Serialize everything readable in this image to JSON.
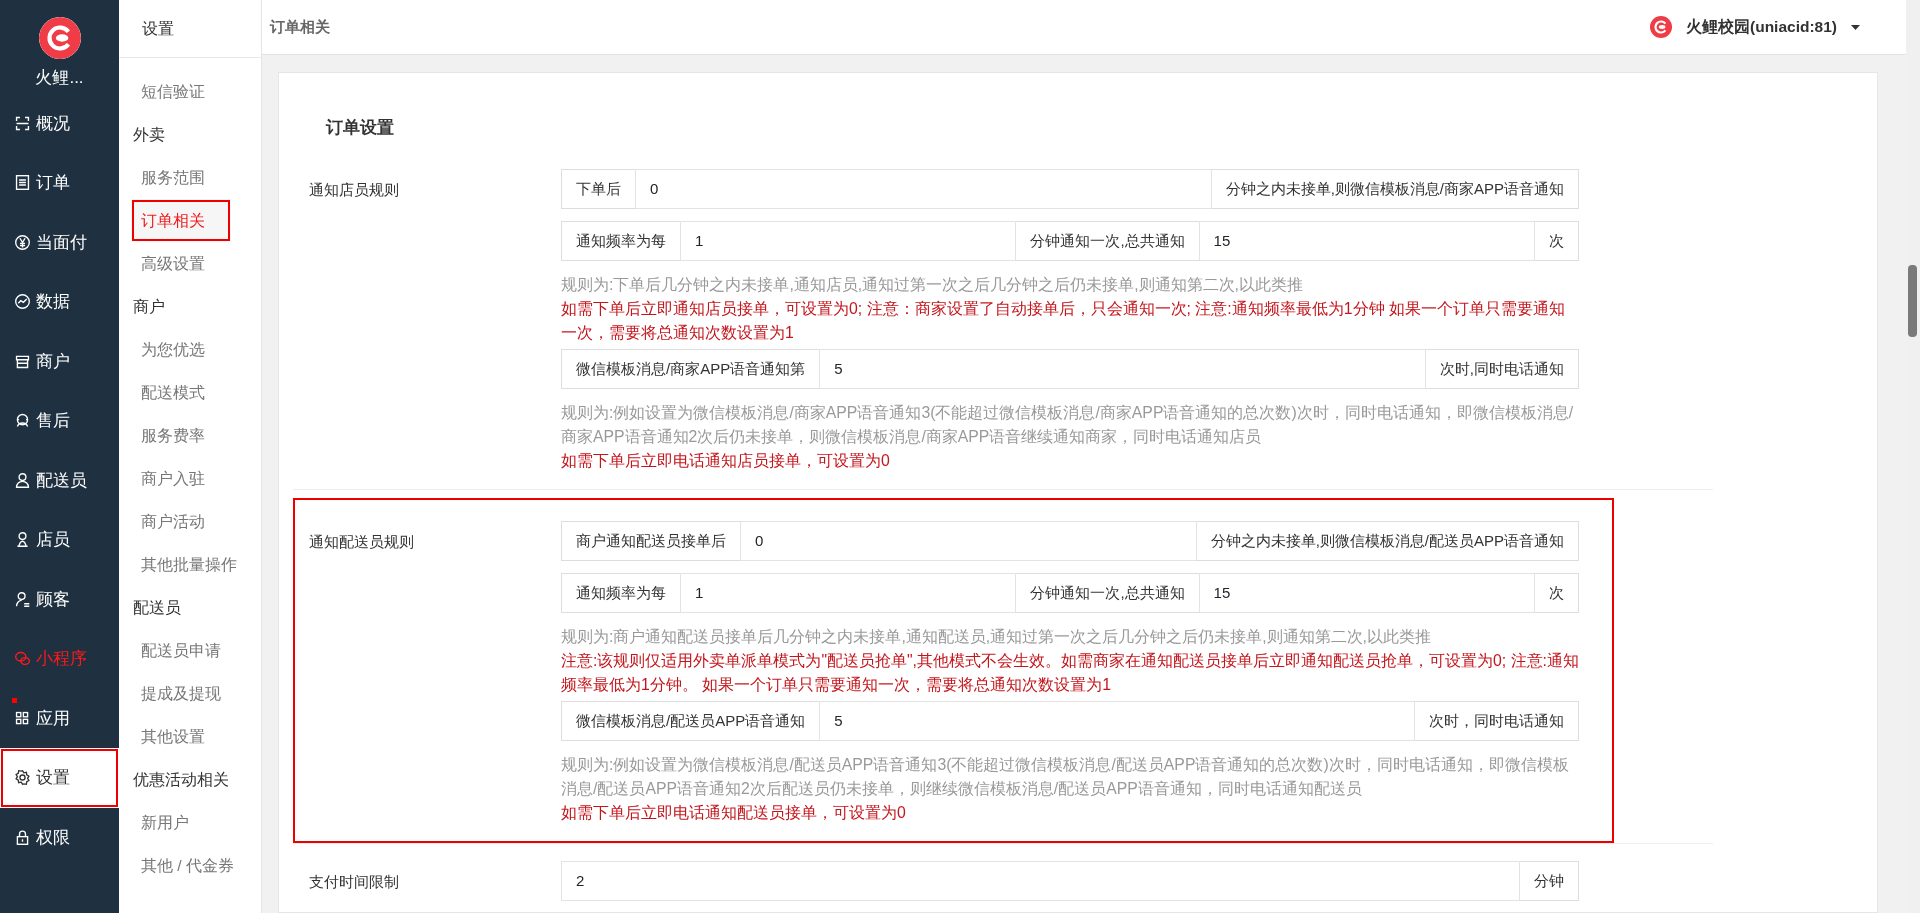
{
  "sidebar": {
    "app_name": "火鲤...",
    "items": [
      {
        "label": "概况",
        "selected": false,
        "highlighted": false,
        "accent": false
      },
      {
        "label": "订单",
        "selected": false,
        "highlighted": false,
        "accent": false
      },
      {
        "label": "当面付",
        "selected": false,
        "highlighted": false,
        "accent": false
      },
      {
        "label": "数据",
        "selected": false,
        "highlighted": false,
        "accent": false
      },
      {
        "label": "商户",
        "selected": false,
        "highlighted": false,
        "accent": false
      },
      {
        "label": "售后",
        "selected": false,
        "highlighted": false,
        "accent": false
      },
      {
        "label": "配送员",
        "selected": false,
        "highlighted": false,
        "accent": false
      },
      {
        "label": "店员",
        "selected": false,
        "highlighted": false,
        "accent": false
      },
      {
        "label": "顾客",
        "selected": false,
        "highlighted": false,
        "accent": false
      },
      {
        "label": "小程序",
        "selected": false,
        "highlighted": false,
        "accent": true
      },
      {
        "label": "应用",
        "selected": false,
        "highlighted": false,
        "accent": false
      },
      {
        "label": "设置",
        "selected": true,
        "highlighted": true,
        "accent": false
      },
      {
        "label": "权限",
        "selected": false,
        "highlighted": false,
        "accent": false
      }
    ]
  },
  "subnav": {
    "title": "设置",
    "entries": [
      {
        "kind": "link",
        "label": "短信验证",
        "selected": false,
        "highlighted": false
      },
      {
        "kind": "group",
        "label": "外卖"
      },
      {
        "kind": "link",
        "label": "服务范围",
        "selected": false,
        "highlighted": false
      },
      {
        "kind": "link",
        "label": "订单相关",
        "selected": true,
        "highlighted": true
      },
      {
        "kind": "link",
        "label": "高级设置",
        "selected": false,
        "highlighted": false
      },
      {
        "kind": "group",
        "label": "商户"
      },
      {
        "kind": "link",
        "label": "为您优选",
        "selected": false,
        "highlighted": false
      },
      {
        "kind": "link",
        "label": "配送模式",
        "selected": false,
        "highlighted": false
      },
      {
        "kind": "link",
        "label": "服务费率",
        "selected": false,
        "highlighted": false
      },
      {
        "kind": "link",
        "label": "商户入驻",
        "selected": false,
        "highlighted": false
      },
      {
        "kind": "link",
        "label": "商户活动",
        "selected": false,
        "highlighted": false
      },
      {
        "kind": "link",
        "label": "其他批量操作",
        "selected": false,
        "highlighted": false
      },
      {
        "kind": "group",
        "label": "配送员"
      },
      {
        "kind": "link",
        "label": "配送员申请",
        "selected": false,
        "highlighted": false
      },
      {
        "kind": "link",
        "label": "提成及提现",
        "selected": false,
        "highlighted": false
      },
      {
        "kind": "link",
        "label": "其他设置",
        "selected": false,
        "highlighted": false
      },
      {
        "kind": "group",
        "label": "优惠活动相关"
      },
      {
        "kind": "link",
        "label": "新用户",
        "selected": false,
        "highlighted": false
      },
      {
        "kind": "link",
        "label": "其他 / 代金券",
        "selected": false,
        "highlighted": false
      }
    ]
  },
  "header": {
    "title": "订单相关",
    "account": "火鲤校园(uniacid:81)"
  },
  "form": {
    "title": "订单设置",
    "sections": [
      {
        "label": "通知店员规则",
        "highlighted": false,
        "blocks": [
          {
            "kind": "group",
            "parts": [
              {
                "kind": "addon",
                "text": "下单后"
              },
              {
                "kind": "input",
                "value": "0"
              },
              {
                "kind": "addon",
                "text": "分钟之内未接单,则微信模板消息/商家APP语音通知"
              }
            ]
          },
          {
            "kind": "group",
            "parts": [
              {
                "kind": "addon",
                "text": "通知频率为每"
              },
              {
                "kind": "input",
                "value": "1"
              },
              {
                "kind": "addon",
                "text": "分钟通知一次,总共通知"
              },
              {
                "kind": "input",
                "value": "15"
              },
              {
                "kind": "addon",
                "text": "次"
              }
            ]
          },
          {
            "kind": "note",
            "warning": false,
            "text": "规则为:下单后几分钟之内未接单,通知店员,通知过第一次之后几分钟之后仍未接单,则通知第二次,以此类推"
          },
          {
            "kind": "note",
            "warning": true,
            "text": "如需下单后立即通知店员接单，可设置为0; 注意：商家设置了自动接单后，只会通知一次; 注意:通知频率最低为1分钟 如果一个订单只需要通知一次，需要将总通知次数设置为1"
          },
          {
            "kind": "group",
            "parts": [
              {
                "kind": "addon",
                "text": "微信模板消息/商家APP语音通知第"
              },
              {
                "kind": "input",
                "value": "5"
              },
              {
                "kind": "addon",
                "text": "次时,同时电话通知"
              }
            ]
          },
          {
            "kind": "note",
            "warning": false,
            "text": "规则为:例如设置为微信模板消息/商家APP语音通知3(不能超过微信模板消息/商家APP语音通知的总次数)次时，同时电话通知，即微信模板消息/商家APP语音通知2次后仍未接单，则微信模板消息/商家APP语音继续通知商家，同时电话通知店员"
          },
          {
            "kind": "note",
            "warning": true,
            "text": "如需下单后立即电话通知店员接单，可设置为0"
          }
        ]
      },
      {
        "label": "通知配送员规则",
        "highlighted": true,
        "blocks": [
          {
            "kind": "group",
            "parts": [
              {
                "kind": "addon",
                "text": "商户通知配送员接单后"
              },
              {
                "kind": "input",
                "value": "0"
              },
              {
                "kind": "addon",
                "text": "分钟之内未接单,则微信模板消息/配送员APP语音通知"
              }
            ]
          },
          {
            "kind": "group",
            "parts": [
              {
                "kind": "addon",
                "text": "通知频率为每"
              },
              {
                "kind": "input",
                "value": "1"
              },
              {
                "kind": "addon",
                "text": "分钟通知一次,总共通知"
              },
              {
                "kind": "input",
                "value": "15"
              },
              {
                "kind": "addon",
                "text": "次"
              }
            ]
          },
          {
            "kind": "note",
            "warning": false,
            "text": "规则为:商户通知配送员接单后几分钟之内未接单,通知配送员,通知过第一次之后几分钟之后仍未接单,则通知第二次,以此类推"
          },
          {
            "kind": "note",
            "warning": true,
            "text": "注意:该规则仅适用外卖单派单模式为\"配送员抢单\",其他模式不会生效。如需商家在通知配送员接单后立即通知配送员抢单，可设置为0; 注意:通知频率最低为1分钟。 如果一个订单只需要通知一次，需要将总通知次数设置为1"
          },
          {
            "kind": "group",
            "parts": [
              {
                "kind": "addon",
                "text": "微信模板消息/配送员APP语音通知"
              },
              {
                "kind": "input",
                "value": "5"
              },
              {
                "kind": "addon",
                "text": "次时，同时电话通知"
              }
            ]
          },
          {
            "kind": "note",
            "warning": false,
            "text": "规则为:例如设置为微信模板消息/配送员APP语音通知3(不能超过微信模板消息/配送员APP语音通知的总次数)次时，同时电话通知，即微信模板消息/配送员APP语音通知2次后配送员仍未接单，则继续微信模板消息/配送员APP语音通知，同时电话通知配送员"
          },
          {
            "kind": "note",
            "warning": true,
            "text": "如需下单后立即电话通知配送员接单，可设置为0"
          }
        ]
      },
      {
        "label": "支付时间限制",
        "highlighted": false,
        "blocks": [
          {
            "kind": "group",
            "parts": [
              {
                "kind": "input",
                "value": "2"
              },
              {
                "kind": "addon",
                "text": "分钟"
              }
            ]
          }
        ]
      }
    ]
  }
}
